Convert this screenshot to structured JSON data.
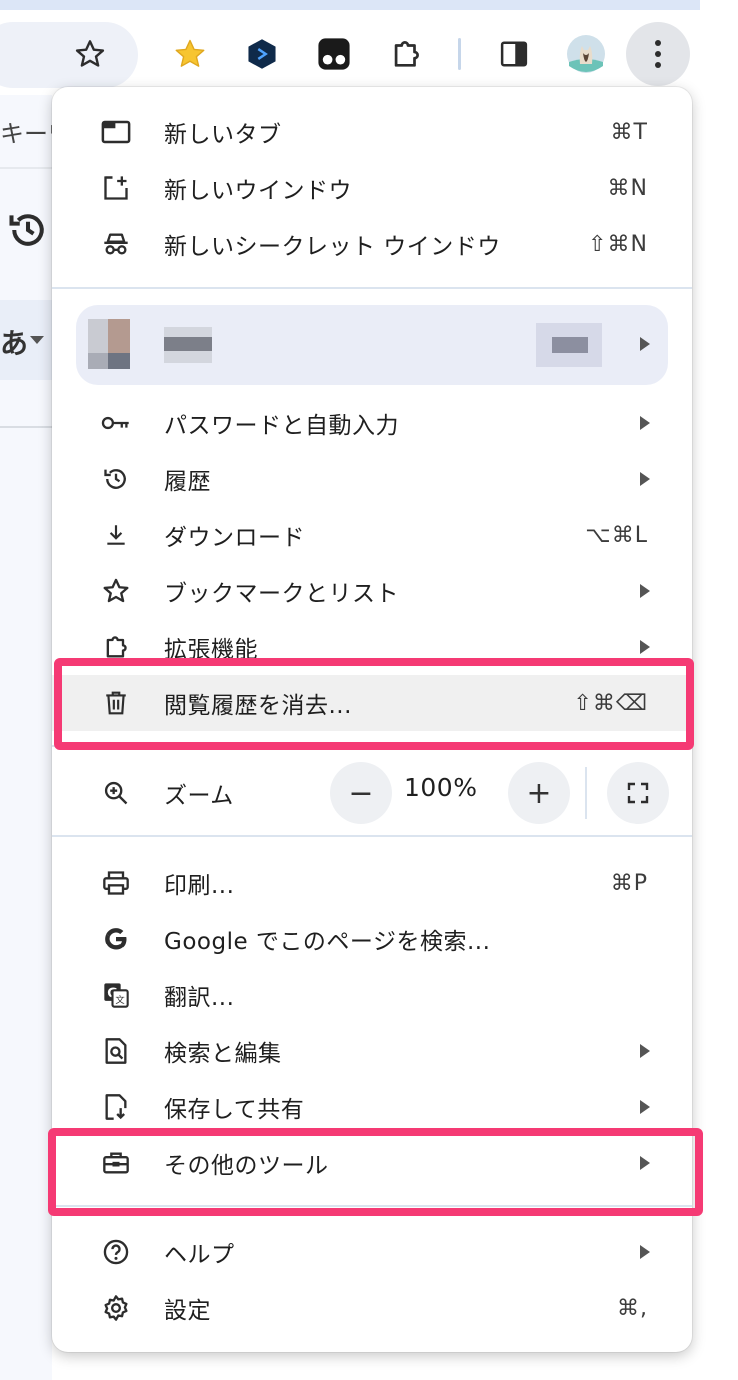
{
  "background": {
    "address_hint_text": "キーワ",
    "ime_indicator": "あ"
  },
  "toolbar": {
    "icons": [
      "bookmark-star-icon",
      "favorite-star-extension-icon",
      "diamond-extension-icon",
      "tampermonkey-extension-icon",
      "extensions-puzzle-icon",
      "side-panel-icon",
      "profile-avatar",
      "kebab-menu-icon"
    ]
  },
  "menu": {
    "new_tab": {
      "label": "新しいタブ",
      "shortcut": "⌘T"
    },
    "new_window": {
      "label": "新しいウインドウ",
      "shortcut": "⌘N"
    },
    "incognito": {
      "label": "新しいシークレット ウインドウ",
      "shortcut": "⇧⌘N"
    },
    "passwords": {
      "label": "パスワードと自動入力"
    },
    "history": {
      "label": "履歴"
    },
    "downloads": {
      "label": "ダウンロード",
      "shortcut": "⌥⌘L"
    },
    "bookmarks": {
      "label": "ブックマークとリスト"
    },
    "extensions": {
      "label": "拡張機能"
    },
    "clear_data": {
      "label": "閲覧履歴を消去...",
      "shortcut": "⇧⌘⌫"
    },
    "zoom": {
      "label": "ズーム",
      "minus": "−",
      "value": "100%",
      "plus": "+"
    },
    "print": {
      "label": "印刷...",
      "shortcut": "⌘P"
    },
    "google_search": {
      "label": "Google でこのページを検索..."
    },
    "translate": {
      "label": "翻訳..."
    },
    "find_edit": {
      "label": "検索と編集"
    },
    "save_share": {
      "label": "保存して共有"
    },
    "more_tools": {
      "label": "その他のツール"
    },
    "help": {
      "label": "ヘルプ"
    },
    "settings": {
      "label": "設定",
      "shortcut": "⌘,"
    }
  },
  "colors": {
    "highlight": "#f53a74",
    "menu_bg": "#ffffff",
    "profile_bg": "#eaedf7"
  }
}
